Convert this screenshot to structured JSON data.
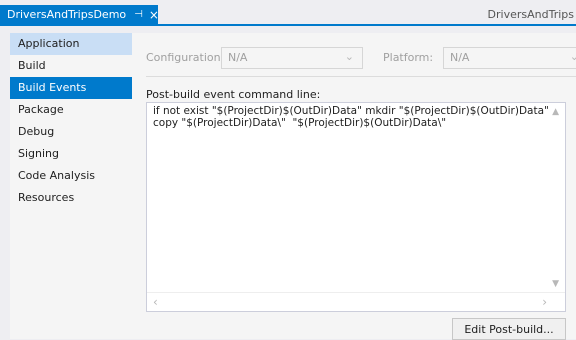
{
  "tabs": {
    "active": {
      "label": "DriversAndTripsDemo",
      "pin": "⊣",
      "close": "×"
    },
    "inactive": {
      "label": "DriversAndTrips"
    }
  },
  "sidebar": {
    "items": [
      {
        "label": "Application"
      },
      {
        "label": "Build"
      },
      {
        "label": "Build Events"
      },
      {
        "label": "Package"
      },
      {
        "label": "Debug"
      },
      {
        "label": "Signing"
      },
      {
        "label": "Code Analysis"
      },
      {
        "label": "Resources"
      }
    ]
  },
  "config": {
    "configuration_label": "Configuration:",
    "configuration_value": "N/A",
    "platform_label": "Platform:",
    "platform_value": "N/A"
  },
  "post_build": {
    "label": "Post-build event command line:",
    "command": "if not exist \"$(ProjectDir)$(OutDir)Data\" mkdir \"$(ProjectDir)$(OutDir)Data\"\ncopy \"$(ProjectDir)Data\\\"  \"$(ProjectDir)$(OutDir)Data\\\"",
    "edit_button": "Edit Post-build..."
  },
  "colors": {
    "accent": "#007acc",
    "hover": "#c9def5"
  }
}
